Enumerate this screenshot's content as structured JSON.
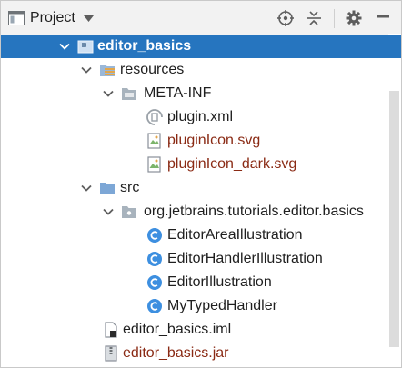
{
  "toolbar": {
    "view_label": "Project",
    "icons": [
      "project-window-icon",
      "dropdown-icon",
      "locate-icon",
      "collapse-all-icon",
      "gear-icon",
      "hide-icon"
    ]
  },
  "tree": {
    "root": {
      "label": "editor_basics",
      "icon": "module-icon"
    },
    "resources": {
      "label": "resources",
      "icon": "resources-folder-icon"
    },
    "meta_inf": {
      "label": "META-INF",
      "icon": "folder-icon"
    },
    "plugin_xml": {
      "label": "plugin.xml",
      "icon": "plugin-xml-icon"
    },
    "plugin_icon": {
      "label": "pluginIcon.svg",
      "icon": "svg-file-icon"
    },
    "plugin_icon_dark": {
      "label": "pluginIcon_dark.svg",
      "icon": "svg-file-icon"
    },
    "src": {
      "label": "src",
      "icon": "source-folder-icon"
    },
    "package": {
      "label": "org.jetbrains.tutorials.editor.basics",
      "icon": "package-icon"
    },
    "classes": [
      {
        "label": "EditorAreaIllustration",
        "icon": "class-icon"
      },
      {
        "label": "EditorHandlerIllustration",
        "icon": "class-icon"
      },
      {
        "label": "EditorIllustration",
        "icon": "class-icon"
      },
      {
        "label": "MyTypedHandler",
        "icon": "class-icon"
      }
    ],
    "iml": {
      "label": "editor_basics.iml",
      "icon": "iml-file-icon"
    },
    "jar": {
      "label": "editor_basics.jar",
      "icon": "jar-file-icon"
    }
  },
  "colors": {
    "selection": "#2675bf",
    "excluded_text": "#8a2a14",
    "folder_blue": "#7da7d6",
    "class_icon": "#3d8fe0"
  }
}
